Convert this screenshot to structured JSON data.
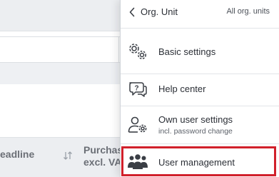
{
  "background": {
    "columns": {
      "deadline": "eadline",
      "purchase_line1": "Purchas",
      "purchase_line2": "excl. VA"
    },
    "sort_icon": "sort-arrows-icon"
  },
  "menu": {
    "header": {
      "back_icon": "chevron-left-icon",
      "title": "Org. Unit",
      "all_units": "All org. units"
    },
    "items": [
      {
        "icon": "gears-icon",
        "label": "Basic settings"
      },
      {
        "icon": "help-bubble-icon",
        "label": "Help center"
      },
      {
        "icon": "user-settings-icon",
        "label": "Own user settings",
        "sublabel": "incl. password change"
      },
      {
        "icon": "users-group-icon",
        "label": "User management",
        "highlighted": true
      }
    ]
  },
  "colors": {
    "highlight": "#d1202b",
    "panel_border": "#cfd3d8",
    "background_gray": "#eceef1"
  }
}
